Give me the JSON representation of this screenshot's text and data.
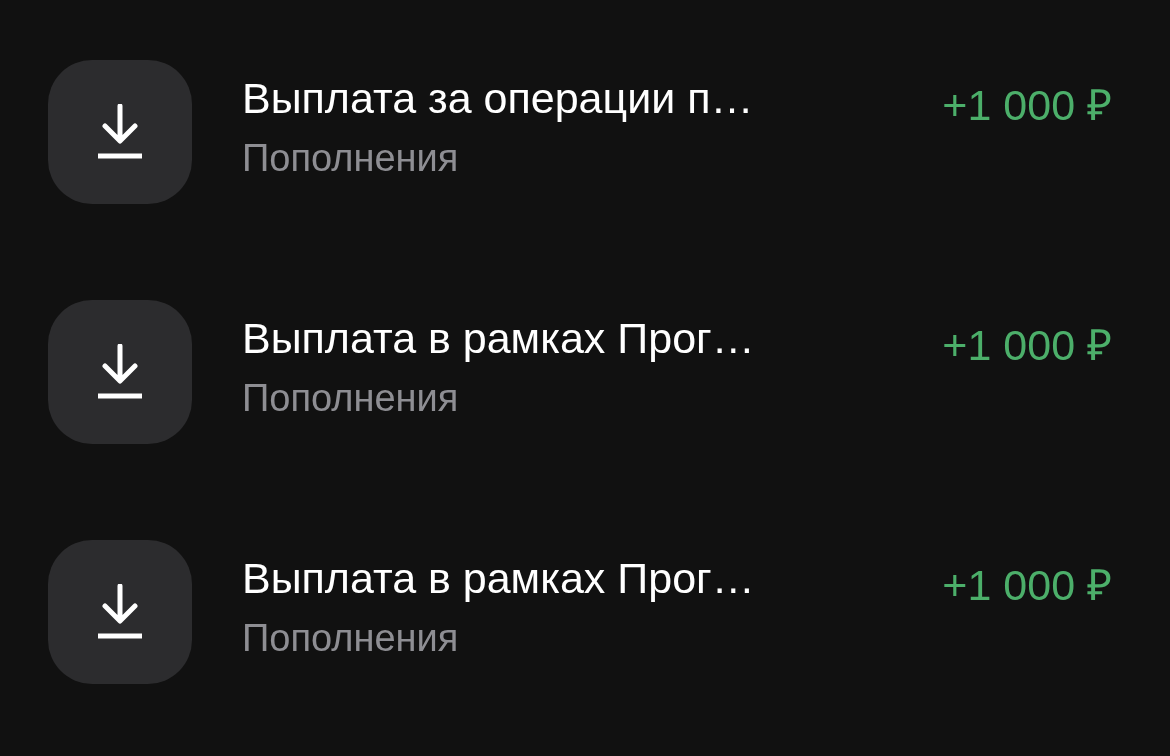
{
  "transactions": [
    {
      "title": "Выплата за операции п…",
      "category": "Пополнения",
      "amount": "+1 000 ₽"
    },
    {
      "title": "Выплата в рамках Прог…",
      "category": "Пополнения",
      "amount": "+1 000 ₽"
    },
    {
      "title": "Выплата в рамках Прог…",
      "category": "Пополнения",
      "amount": "+1 000 ₽"
    }
  ]
}
